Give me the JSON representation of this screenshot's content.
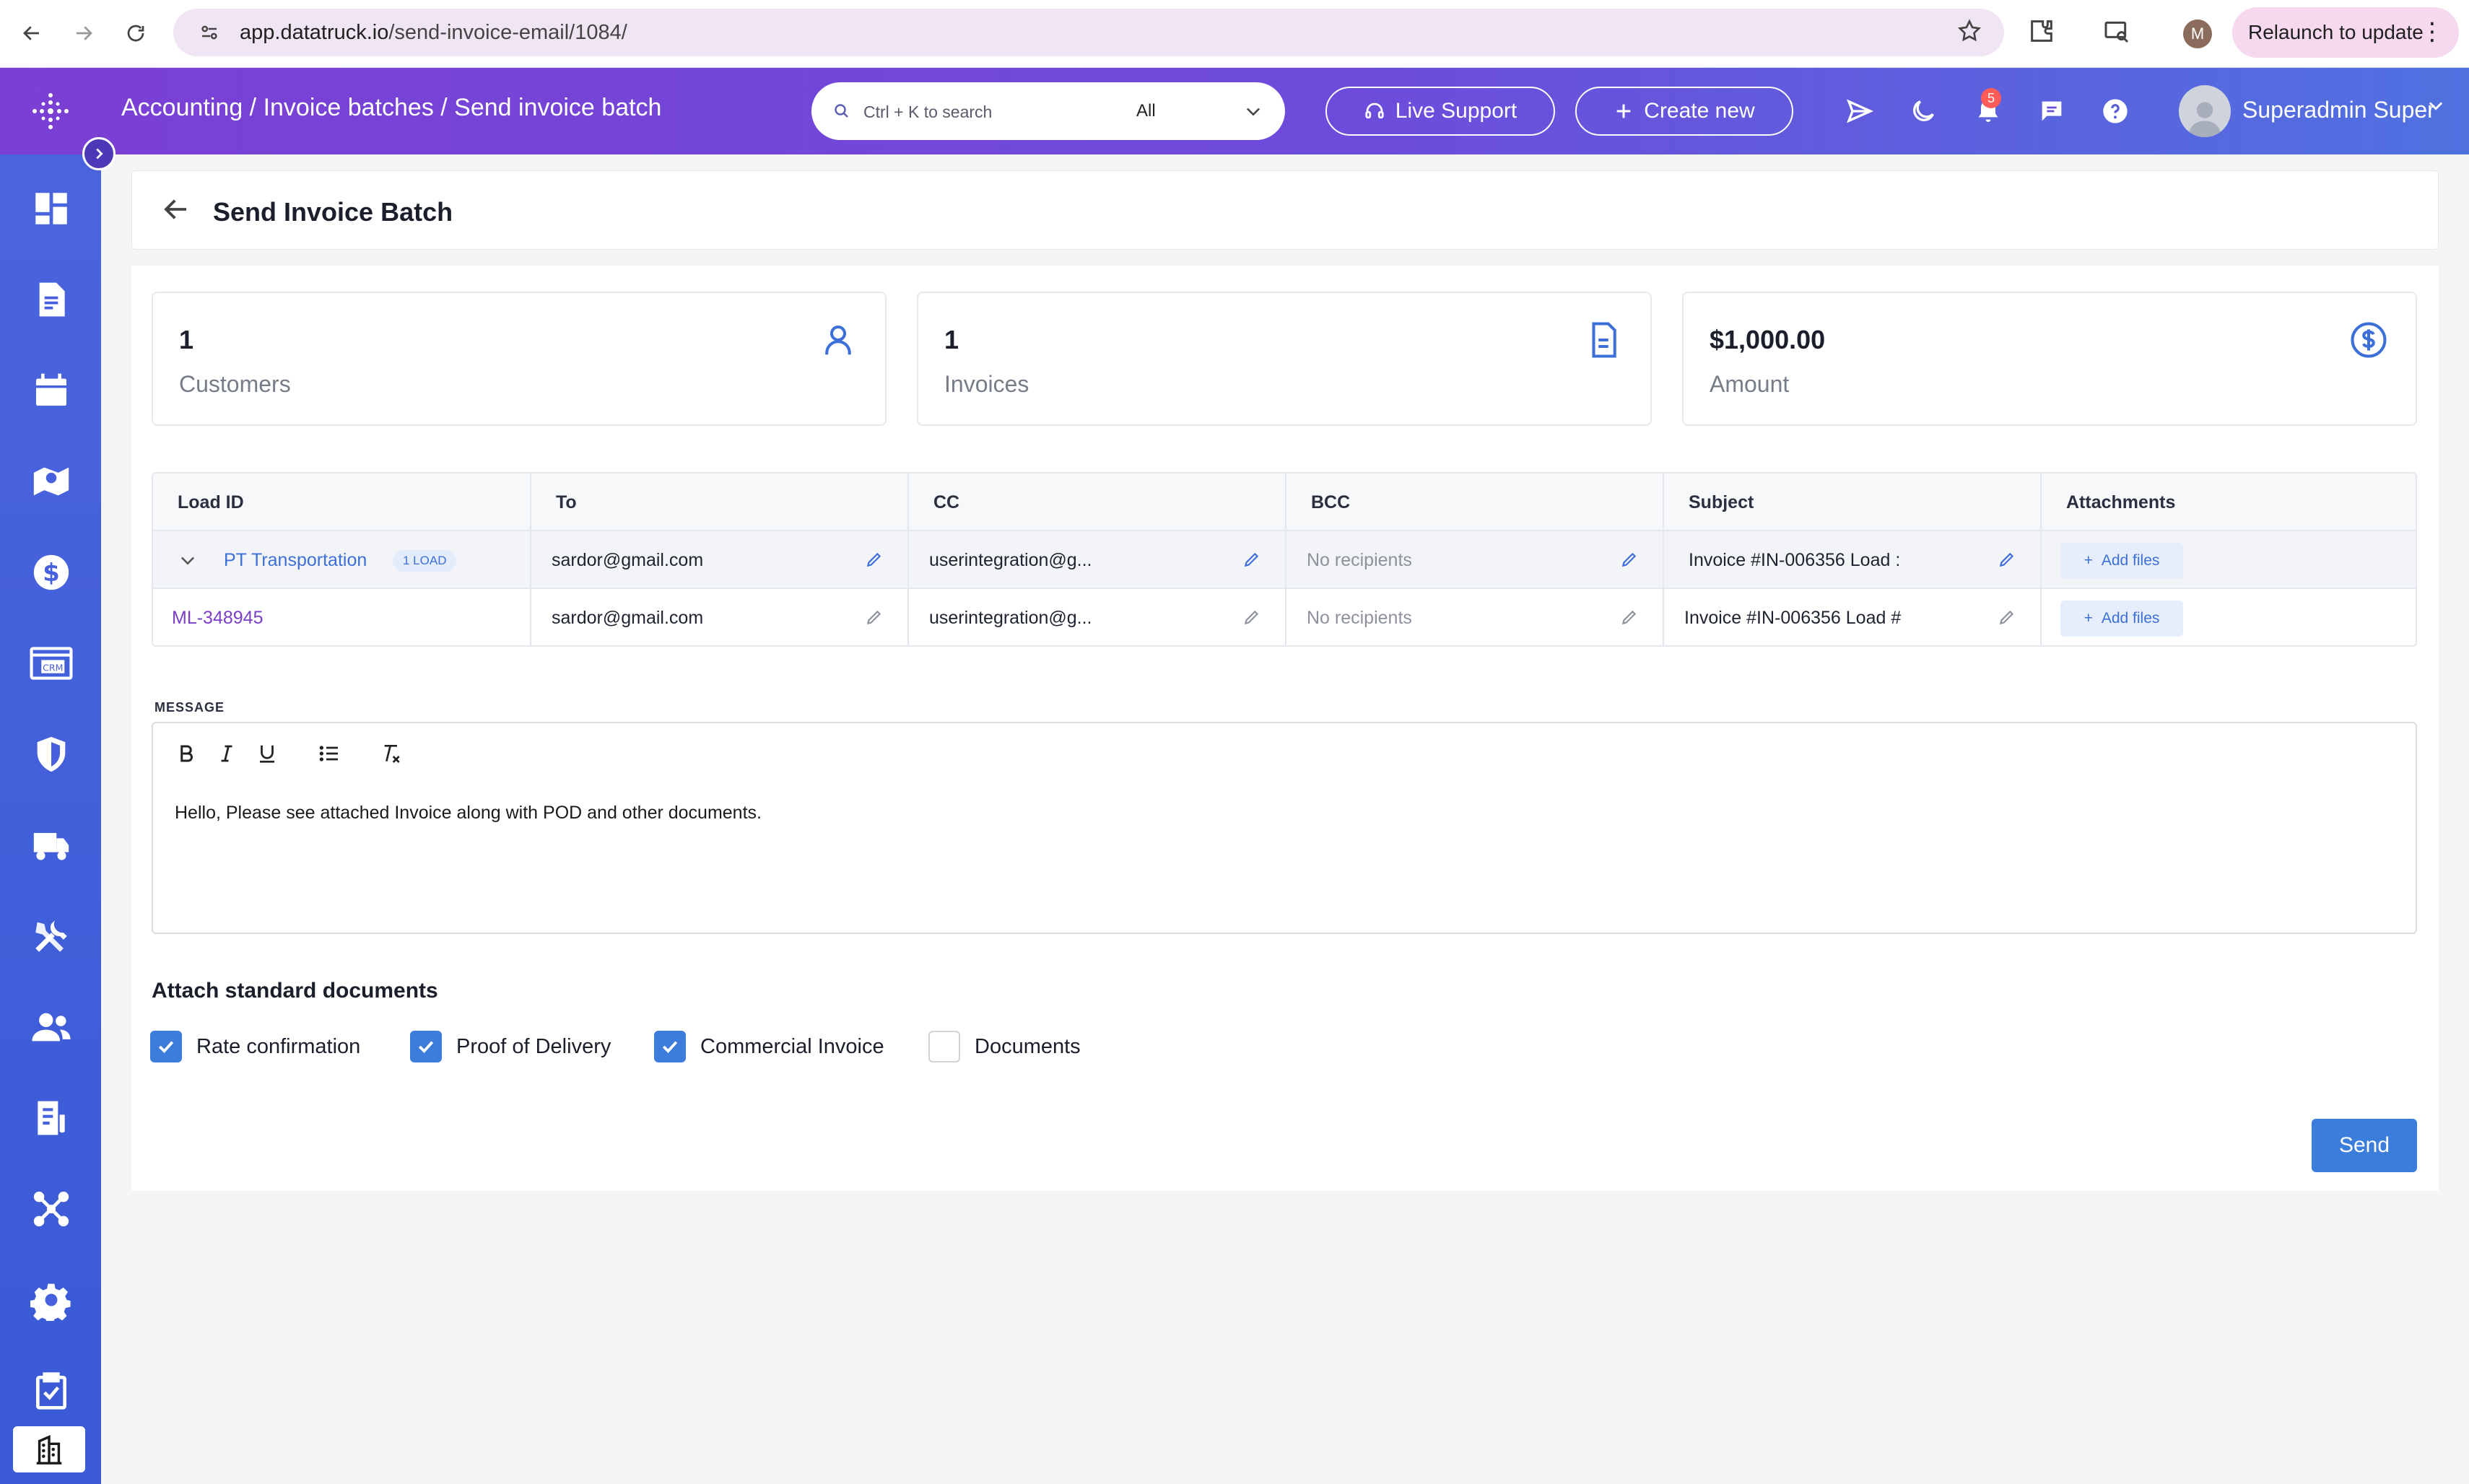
{
  "browser": {
    "url_host": "app.datatruck.io",
    "url_path": "/send-invoice-email/1084/",
    "profile_initial": "M",
    "relaunch_label": "Relaunch to update"
  },
  "header": {
    "breadcrumb": "Accounting / Invoice batches / Send invoice batch",
    "search_placeholder": "Ctrl + K to search",
    "search_scope": "All",
    "live_support_label": "Live Support",
    "create_new_label": "Create new",
    "notification_count": "5",
    "user_name": "Superadmin Super"
  },
  "page": {
    "title": "Send Invoice Batch"
  },
  "stats": [
    {
      "value": "1",
      "label": "Customers",
      "icon": "user-icon"
    },
    {
      "value": "1",
      "label": "Invoices",
      "icon": "document-icon"
    },
    {
      "value": "$1,000.00",
      "label": "Amount",
      "icon": "dollar-icon"
    }
  ],
  "table": {
    "headers": [
      "Load ID",
      "To",
      "CC",
      "BCC",
      "Subject",
      "Attachments"
    ],
    "group_row": {
      "customer": "PT Transportation",
      "load_count": "1 LOAD",
      "to": "sardor@gmail.com",
      "cc": "userintegration@g...",
      "bcc": "No recipients",
      "subject": "Invoice #IN-006356 Load :",
      "attachments_label": "Add files"
    },
    "rows": [
      {
        "load_id": "ML-348945",
        "to": "sardor@gmail.com",
        "cc": "userintegration@g...",
        "bcc": "No recipients",
        "subject": "Invoice #IN-006356 Load #",
        "attachments_label": "Add files"
      }
    ]
  },
  "message": {
    "label": "MESSAGE",
    "body": "Hello, Please see attached Invoice along with POD and other documents."
  },
  "attach": {
    "title": "Attach standard documents",
    "options": [
      {
        "label": "Rate confirmation",
        "checked": true
      },
      {
        "label": "Proof of Delivery",
        "checked": true
      },
      {
        "label": "Commercial Invoice",
        "checked": true
      },
      {
        "label": "Documents",
        "checked": false
      }
    ]
  },
  "actions": {
    "send_label": "Send"
  },
  "colors": {
    "accent": "#3d6fd8",
    "header_start": "#7b3fd4",
    "header_end": "#4f71e0",
    "sidebar": "#4b64de"
  }
}
